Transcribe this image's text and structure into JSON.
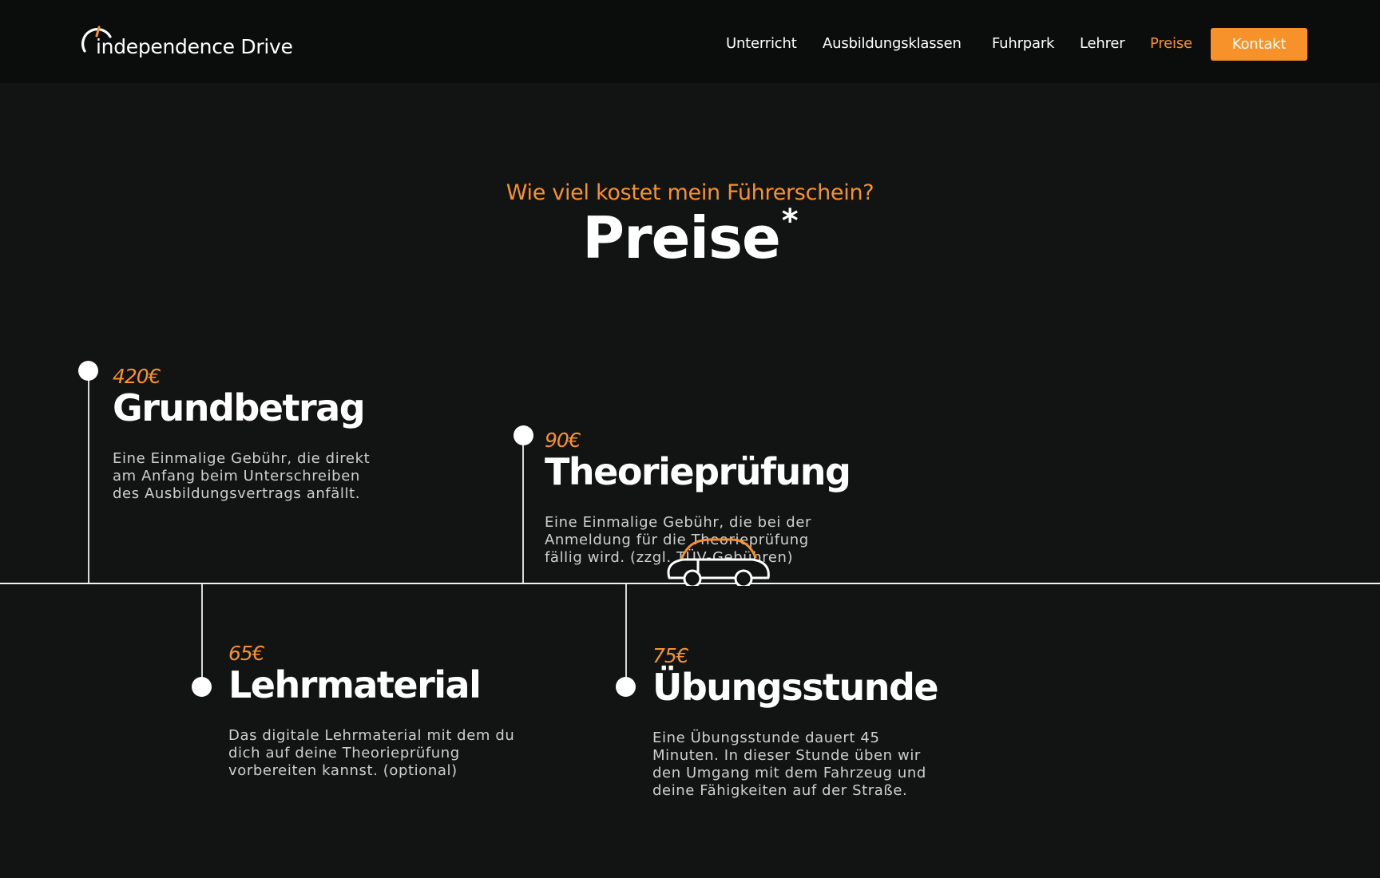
{
  "brand": {
    "name": "independence Drive"
  },
  "nav": {
    "items": [
      {
        "label": "Unterricht"
      },
      {
        "label": "Ausbildungsklassen"
      },
      {
        "label": "Fuhrpark"
      },
      {
        "label": "Lehrer"
      },
      {
        "label": "Preise",
        "active": true
      }
    ],
    "contact_label": "Kontakt"
  },
  "hero": {
    "subtitle": "Wie viel kostet mein Führerschein?",
    "title": "Preise",
    "title_mark": "*"
  },
  "prices": [
    {
      "price": "420€",
      "title": "Grundbetrag",
      "description": "Eine Einmalige Gebühr, die direkt\nam Anfang beim Unterschreiben\ndes Ausbildungsvertrags anfällt."
    },
    {
      "price": "90€",
      "title": "Theorieprüfung",
      "description": "Eine Einmalige Gebühr, die bei der\nAnmeldung für die Theorieprüfung\nfällig wird. (zzgl. TÜV-Gebühren)"
    },
    {
      "price": "65€",
      "title": "Lehrmaterial",
      "description": "Das digitale Lehrmaterial mit dem du\ndich auf deine Theorieprüfung\nvorbereiten kannst. (optional)"
    },
    {
      "price": "75€",
      "title": "Übungsstunde",
      "description": "Eine Übungsstunde dauert 45\nMinuten. In dieser Stunde üben wir\nden Umgang mit dem Fahrzeug und\ndeine Fähigkeiten auf der Straße."
    }
  ],
  "colors": {
    "accent": "#f7922b",
    "background": "#121313",
    "nav_background": "#0b0c0c",
    "text": "#ffffff",
    "muted_text": "#cfcfcf"
  },
  "icons": {
    "logo": "speedometer-arc-icon",
    "car": "car-icon"
  }
}
